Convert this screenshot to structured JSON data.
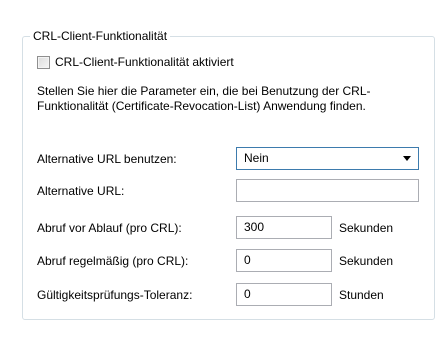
{
  "group": {
    "title": "CRL-Client-Funktionalität"
  },
  "checkbox": {
    "label": "CRL-Client-Funktionalität aktiviert",
    "checked": false
  },
  "description": "Stellen Sie hier die Parameter ein, die bei Benutzung der CRL-Funktionalität (Certificate-Revocation-List) Anwendung finden.",
  "fields": {
    "alt_url_use": {
      "label": "Alternative URL benutzen:",
      "selected": "Nein"
    },
    "alt_url": {
      "label": "Alternative URL:",
      "value": ""
    },
    "fetch_before_expiry": {
      "label": "Abruf vor Ablauf (pro CRL):",
      "value": "300",
      "unit": "Sekunden"
    },
    "fetch_regular": {
      "label": "Abruf regelmäßig (pro CRL):",
      "value": "0",
      "unit": "Sekunden"
    },
    "validity_tolerance": {
      "label": "Gültigkeitsprüfungs-Toleranz:",
      "value": "0",
      "unit": "Stunden"
    }
  },
  "icons": {
    "dropdown": "chevron-down-icon"
  }
}
